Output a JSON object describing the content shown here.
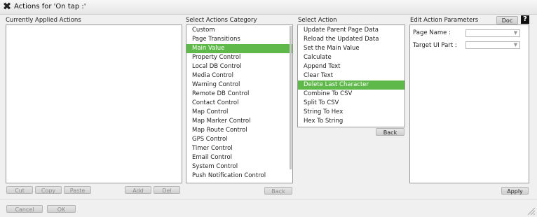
{
  "window": {
    "title": "Actions for 'On tap :'"
  },
  "labels": {
    "applied": "Currently Applied Actions",
    "category": "Select Actions Category",
    "action": "Select Action",
    "params": "Edit Action Parameters"
  },
  "buttons": {
    "cut": "Cut",
    "copy": "Copy",
    "paste": "Paste",
    "add": "Add",
    "del": "Del",
    "category_back": "Back",
    "action_back": "Back",
    "apply": "Apply",
    "doc": "Doc",
    "cancel": "Cancel",
    "ok": "OK"
  },
  "categories": [
    "Custom",
    "Page Transitions",
    "Main Value",
    "Property Control",
    "Local DB Control",
    "Media Control",
    "Warning Control",
    "Remote DB Control",
    "Contact Control",
    "Map Control",
    "Map Marker Control",
    "Map Route Control",
    "GPS Control",
    "Timer Control",
    "Email Control",
    "System Control",
    "Push Notification Control"
  ],
  "selected_category": "Main Value",
  "actions": [
    "Update Parent Page Data",
    "Reload the Updated Data",
    "Set the Main Value",
    "Calculate",
    "Append Text",
    "Clear Text",
    "Delete Last Character",
    "Combine To CSV",
    "Split To CSV",
    "String To Hex",
    "Hex To String"
  ],
  "selected_action": "Delete Last Character",
  "params": {
    "page_name_label": "Page Name :",
    "target_label": "Target UI Part :",
    "page_name_value": "",
    "target_value": ""
  },
  "icons": {
    "close": "close-x-icon",
    "help": "help-icon"
  },
  "colors": {
    "selection": "#5fb84a"
  }
}
